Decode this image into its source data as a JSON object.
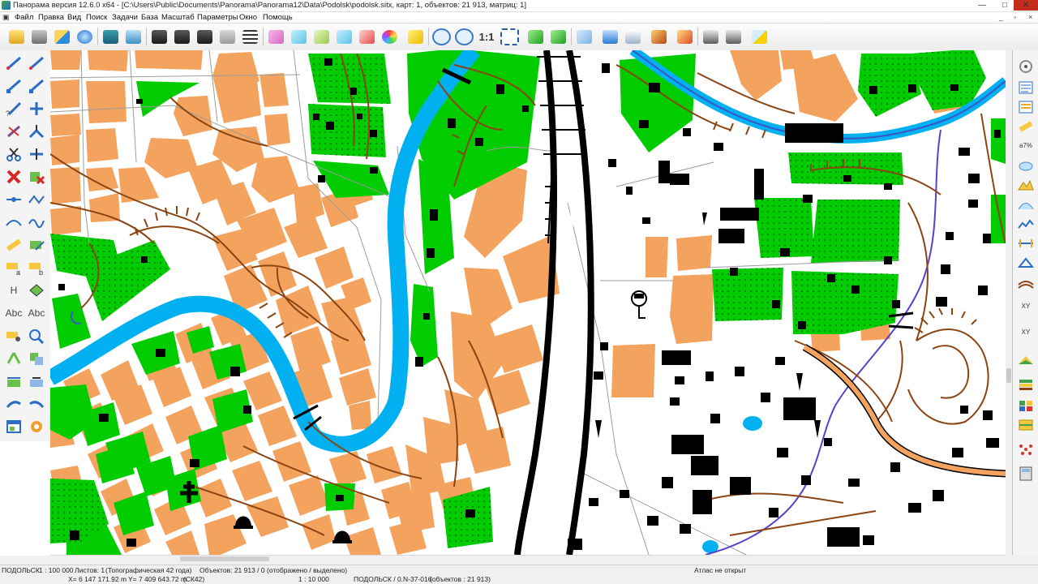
{
  "window": {
    "title": "Панорама версия 12.6.0 x64 - [C:\\Users\\Public\\Documents\\Panorama\\Panorama12\\Data\\Podolsk\\podolsk.sitx, карт: 1, объектов: 21 913, матриц: 1]",
    "minimize": "—",
    "maximize": "□",
    "close": "✕"
  },
  "menu": {
    "items": [
      "Файл",
      "Правка",
      "Вид",
      "Поиск",
      "Задачи",
      "База",
      "Масштаб",
      "Параметры",
      "Окно",
      "Помощь"
    ],
    "mdi_controls": [
      "_",
      "▫",
      "×"
    ]
  },
  "toolbar": {
    "scale_one_to_one": "1:1"
  },
  "left_tools": {
    "heading_tool": "H",
    "label_tool_a": "Abc",
    "label_tool_b": "Abc"
  },
  "right_tools": {
    "percent_label": "a7%",
    "xy_label_a": "XY",
    "xy_label_b": "XY"
  },
  "status": {
    "map_name": "ПОДОЛЬСК",
    "scale": "1 : 100 000",
    "sheets": "Листов: 1",
    "map_type": "(Топографическая 42 года)",
    "objects": "Объектов: 21 913 / 0 (отображено / выделено)",
    "atlas": "Атлас не открыт",
    "coord_x": "X= 6 147 171.92 m",
    "coord_y": "Y= 7 409 643.72 m",
    "crs": "(СК42)",
    "view_scale": "1 : 10 000",
    "sheet_info": "ПОДОЛЬСК / 0.N-37-016",
    "sheet_objects": "(объектов : 21 913)"
  },
  "colors": {
    "block_fill": "#f4a35f",
    "vegetation": "#00cc00",
    "water": "#00b0f0",
    "contour": "#8b4513",
    "railway": "#000000",
    "road_casing": "#9c9c9c",
    "purple_stream": "#5b3fd0"
  }
}
